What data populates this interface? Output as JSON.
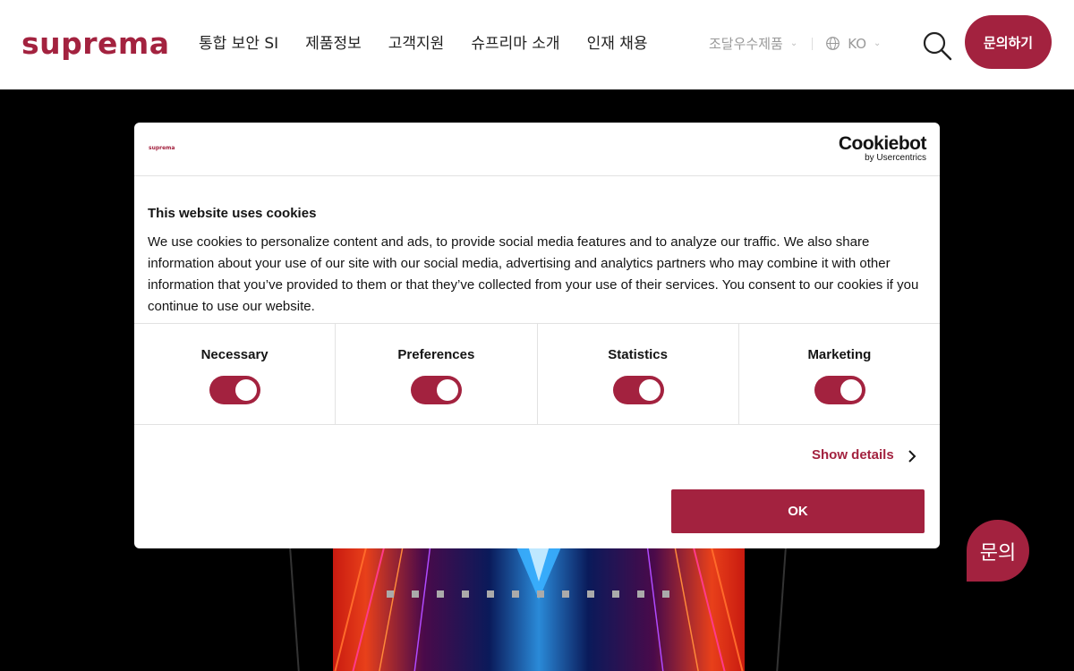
{
  "header": {
    "logo": "suprema",
    "nav": [
      "통합 보안 SI",
      "제품정보",
      "고객지원",
      "슈프리마 소개",
      "인재 채용"
    ],
    "procurement": "조달우수제품",
    "language": "KO",
    "cta": "문의하기"
  },
  "hero": {
    "slide_count": 12
  },
  "cookie_dialog": {
    "site_logo": "suprema",
    "brand": "Cookiebot",
    "brand_sub": "by Usercentrics",
    "title": "This website uses cookies",
    "text": "We use cookies to personalize content and ads, to provide social media features and to analyze our traffic. We also share information about your use of our site with our social media, advertising and analytics partners who may combine it with other information that you’ve provided to them or that they’ve collected from your use of their services. You consent to our cookies if you continue to use our website.",
    "categories": [
      {
        "label": "Necessary",
        "enabled": true
      },
      {
        "label": "Preferences",
        "enabled": true
      },
      {
        "label": "Statistics",
        "enabled": true
      },
      {
        "label": "Marketing",
        "enabled": true
      }
    ],
    "show_details": "Show details",
    "ok": "OK"
  },
  "floating_button": "문의",
  "colors": {
    "brand": "#a3223f",
    "text": "#141414"
  }
}
